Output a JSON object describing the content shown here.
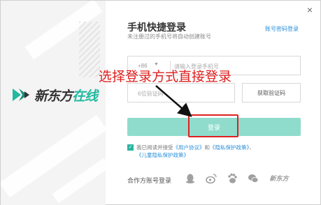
{
  "window": {
    "close_glyph": "×"
  },
  "brand": {
    "name_main": "新东方",
    "name_accent": "在线",
    "accent_color": "#21b9a0"
  },
  "form": {
    "title": "手机快捷登录",
    "subtitle": "未注册过的手机号将自动创建账号",
    "alt_login_link": "账号密码登录",
    "phone_prefix": "+86",
    "phone_placeholder": "请输入登录手机号",
    "phone_value": "",
    "code_placeholder": "6位验证码",
    "code_value": "",
    "get_code_button": "获取验证码",
    "login_button": "登录",
    "login_button_color": "#8fdccd"
  },
  "agreement": {
    "checked": true,
    "prefix": "我已阅读并接受",
    "user_agreement": "《用户协议》",
    "and": "和",
    "privacy_policy": "《隐私保护政策》",
    "separator": "、",
    "child_privacy": "《儿童隐私保护政策》"
  },
  "third_party": {
    "label": "合作方账号登录",
    "icons": [
      "qq-icon",
      "weibo-icon",
      "baidu-icon",
      "wechat-icon",
      "xdf-icon"
    ],
    "brand_icon_text": "新东方"
  },
  "annotation": {
    "text": "选择登录方式直接登录",
    "color": "#e01e1e"
  }
}
